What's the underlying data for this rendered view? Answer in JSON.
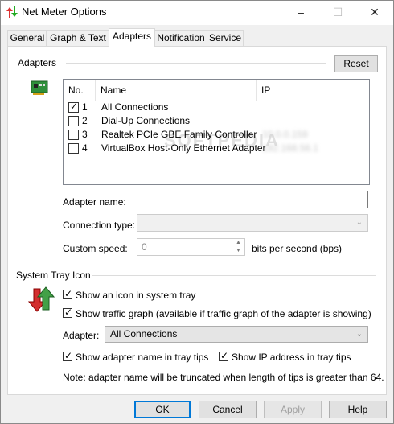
{
  "window": {
    "title": "Net Meter Options"
  },
  "titlebar": {
    "minimize": "–",
    "maximize": "☐",
    "close": "✕"
  },
  "tabs": [
    {
      "label": "General"
    },
    {
      "label": "Graph & Text"
    },
    {
      "label": "Adapters",
      "active": true
    },
    {
      "label": "Notification"
    },
    {
      "label": "Service"
    }
  ],
  "adapters": {
    "group_label": "Adapters",
    "reset_label": "Reset",
    "columns": {
      "no": "No.",
      "name": "Name",
      "ip": "IP"
    },
    "rows": [
      {
        "checked": true,
        "no": "1",
        "name": "All Connections",
        "ip": ""
      },
      {
        "checked": false,
        "no": "2",
        "name": "Dial-Up Connections",
        "ip": ""
      },
      {
        "checked": false,
        "no": "3",
        "name": "Realtek PCIe GBE Family Controller",
        "ip": "10.0.0.159"
      },
      {
        "checked": false,
        "no": "4",
        "name": "VirtualBox Host-Only Ethernet Adapter",
        "ip": "192.168.56.1"
      }
    ],
    "watermark": "SOFTPEDIA",
    "adapter_name_label": "Adapter name:",
    "adapter_name_value": "",
    "connection_type_label": "Connection type:",
    "custom_speed_label": "Custom speed:",
    "custom_speed_value": "0",
    "speed_unit": "bits per second (bps)"
  },
  "tray": {
    "group_label": "System Tray Icon",
    "show_icon_label": "Show an icon in system tray",
    "show_icon_checked": true,
    "show_graph_label": "Show traffic graph (available if traffic graph of the adapter is showing)",
    "show_graph_checked": true,
    "adapter_label": "Adapter:",
    "adapter_selected": "All Connections",
    "show_name_label": "Show adapter name in tray tips",
    "show_name_checked": true,
    "show_ip_label": "Show IP address in tray tips",
    "show_ip_checked": true,
    "note": "Note: adapter name will be truncated when length of tips is greater than 64."
  },
  "footer": {
    "ok": "OK",
    "cancel": "Cancel",
    "apply": "Apply",
    "help": "Help"
  }
}
